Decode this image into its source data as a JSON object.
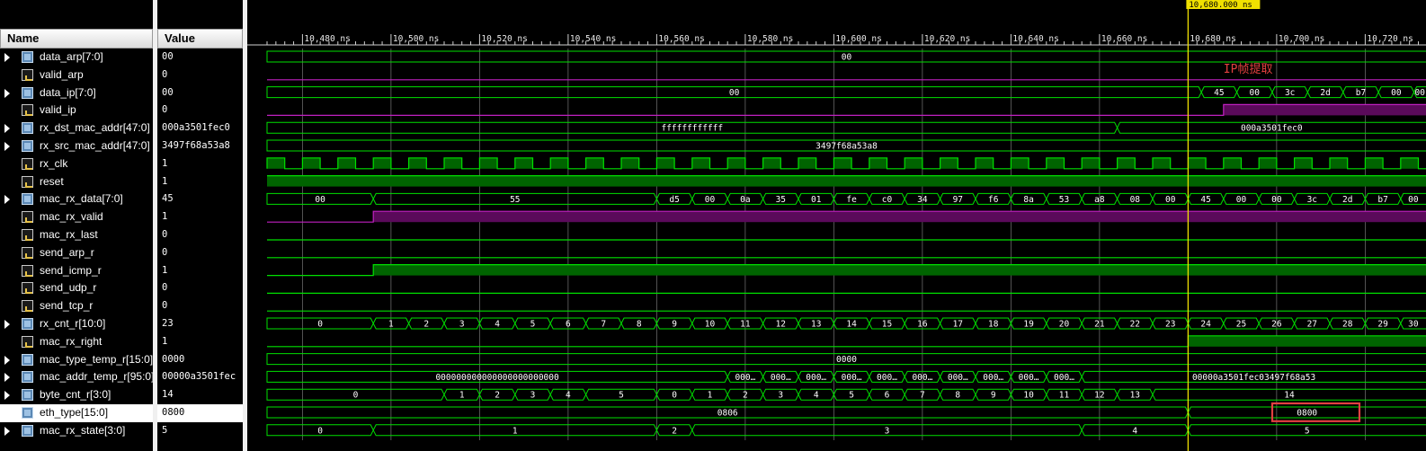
{
  "headers": {
    "name": "Name",
    "value": "Value"
  },
  "cursor": {
    "label": "10,680.000 ns",
    "time": 10680
  },
  "timescale": {
    "start": 10472,
    "end": 10735,
    "ticks": [
      10480,
      10500,
      10520,
      10540,
      10560,
      10580,
      10600,
      10620,
      10640,
      10660,
      10680,
      10700,
      10720
    ],
    "tick_suffix": " ns"
  },
  "annotation": {
    "text": "IP帧提取",
    "color": "#e24040"
  },
  "highlight_box": {
    "signal": "eth_type[15:0]",
    "value": "0800",
    "color": "#e24040"
  },
  "colors": {
    "bus": "#00e000",
    "bit_high_fill": "#006400",
    "purple": "#c020c0",
    "purple_fill": "#5a0a5a",
    "cursor": "#f0e000"
  },
  "signals": [
    {
      "name": "data_arp[7:0]",
      "value": "00",
      "type": "bus"
    },
    {
      "name": "valid_arp",
      "value": "0",
      "type": "bit"
    },
    {
      "name": "data_ip[7:0]",
      "value": "00",
      "type": "bus"
    },
    {
      "name": "valid_ip",
      "value": "0",
      "type": "bit"
    },
    {
      "name": "rx_dst_mac_addr[47:0]",
      "value": "000a3501fec0",
      "type": "bus"
    },
    {
      "name": "rx_src_mac_addr[47:0]",
      "value": "3497f68a53a8",
      "type": "bus"
    },
    {
      "name": "rx_clk",
      "value": "1",
      "type": "bit"
    },
    {
      "name": "reset",
      "value": "1",
      "type": "bit"
    },
    {
      "name": "mac_rx_data[7:0]",
      "value": "45",
      "type": "bus"
    },
    {
      "name": "mac_rx_valid",
      "value": "1",
      "type": "bit"
    },
    {
      "name": "mac_rx_last",
      "value": "0",
      "type": "bit"
    },
    {
      "name": "send_arp_r",
      "value": "0",
      "type": "bit"
    },
    {
      "name": "send_icmp_r",
      "value": "1",
      "type": "bit"
    },
    {
      "name": "send_udp_r",
      "value": "0",
      "type": "bit"
    },
    {
      "name": "send_tcp_r",
      "value": "0",
      "type": "bit"
    },
    {
      "name": "rx_cnt_r[10:0]",
      "value": "23",
      "type": "bus"
    },
    {
      "name": "mac_rx_right",
      "value": "1",
      "type": "bit"
    },
    {
      "name": "mac_type_temp_r[15:0]",
      "value": "0000",
      "type": "bus"
    },
    {
      "name": "mac_addr_temp_r[95:0]",
      "value": "00000a3501fec",
      "type": "bus"
    },
    {
      "name": "byte_cnt_r[3:0]",
      "value": "14",
      "type": "bus"
    },
    {
      "name": "eth_type[15:0]",
      "value": "0800",
      "type": "bus",
      "selected": true
    },
    {
      "name": "mac_rx_state[3:0]",
      "value": "5",
      "type": "bus"
    }
  ],
  "waves": {
    "data_arp": [
      [
        10472,
        "00"
      ]
    ],
    "valid_arp": [
      [
        10472,
        0
      ]
    ],
    "data_ip": [
      [
        10472,
        "00"
      ],
      [
        10683,
        "45"
      ],
      [
        10691,
        "00"
      ],
      [
        10699,
        "3c"
      ],
      [
        10707,
        "2d"
      ],
      [
        10715,
        "b7"
      ],
      [
        10723,
        "00"
      ],
      [
        10731,
        "00"
      ]
    ],
    "valid_ip": [
      [
        10472,
        0
      ],
      [
        10688,
        1
      ]
    ],
    "rx_dst_mac_addr": [
      [
        10472,
        "ffffffffffff"
      ],
      [
        10664,
        "000a3501fec0"
      ]
    ],
    "rx_src_mac_addr": [
      [
        10472,
        "3497f68a53a8"
      ]
    ],
    "rx_clk": {
      "period": 8,
      "phase": 10472
    },
    "reset": [
      [
        10472,
        1
      ]
    ],
    "mac_rx_data": [
      [
        10472,
        "00"
      ],
      [
        10496,
        "55"
      ],
      [
        10560,
        "d5"
      ],
      [
        10568,
        "00"
      ],
      [
        10576,
        "0a"
      ],
      [
        10584,
        "35"
      ],
      [
        10592,
        "01"
      ],
      [
        10600,
        "fe"
      ],
      [
        10608,
        "c0"
      ],
      [
        10616,
        "34"
      ],
      [
        10624,
        "97"
      ],
      [
        10632,
        "f6"
      ],
      [
        10640,
        "8a"
      ],
      [
        10648,
        "53"
      ],
      [
        10656,
        "a8"
      ],
      [
        10664,
        "08"
      ],
      [
        10672,
        "00"
      ],
      [
        10680,
        "45"
      ],
      [
        10688,
        "00"
      ],
      [
        10696,
        "00"
      ],
      [
        10704,
        "3c"
      ],
      [
        10712,
        "2d"
      ],
      [
        10720,
        "b7"
      ],
      [
        10728,
        "00"
      ]
    ],
    "mac_rx_valid": [
      [
        10472,
        0
      ],
      [
        10496,
        1
      ]
    ],
    "mac_rx_last": [
      [
        10472,
        0
      ]
    ],
    "send_arp_r": [
      [
        10472,
        0
      ]
    ],
    "send_icmp_r": [
      [
        10472,
        0
      ],
      [
        10496,
        1
      ]
    ],
    "send_udp_r": [
      [
        10472,
        0
      ]
    ],
    "send_tcp_r": [
      [
        10472,
        0
      ]
    ],
    "rx_cnt_r": [
      [
        10472,
        "0"
      ],
      [
        10496,
        "1"
      ],
      [
        10504,
        "2"
      ],
      [
        10512,
        "3"
      ],
      [
        10520,
        "4"
      ],
      [
        10528,
        "5"
      ],
      [
        10536,
        "6"
      ],
      [
        10544,
        "7"
      ],
      [
        10552,
        "8"
      ],
      [
        10560,
        "9"
      ],
      [
        10568,
        "10"
      ],
      [
        10576,
        "11"
      ],
      [
        10584,
        "12"
      ],
      [
        10592,
        "13"
      ],
      [
        10600,
        "14"
      ],
      [
        10608,
        "15"
      ],
      [
        10616,
        "16"
      ],
      [
        10624,
        "17"
      ],
      [
        10632,
        "18"
      ],
      [
        10640,
        "19"
      ],
      [
        10648,
        "20"
      ],
      [
        10656,
        "21"
      ],
      [
        10664,
        "22"
      ],
      [
        10672,
        "23"
      ],
      [
        10680,
        "24"
      ],
      [
        10688,
        "25"
      ],
      [
        10696,
        "26"
      ],
      [
        10704,
        "27"
      ],
      [
        10712,
        "28"
      ],
      [
        10720,
        "29"
      ],
      [
        10728,
        "30"
      ]
    ],
    "mac_rx_right": [
      [
        10472,
        0
      ],
      [
        10680,
        1
      ]
    ],
    "mac_type_temp_r": [
      [
        10472,
        "0000"
      ]
    ],
    "mac_addr_temp_r": [
      [
        10472,
        "000000000000000000000000"
      ],
      [
        10576,
        "000…"
      ],
      [
        10584,
        "000…"
      ],
      [
        10592,
        "000…"
      ],
      [
        10600,
        "000…"
      ],
      [
        10608,
        "000…"
      ],
      [
        10616,
        "000…"
      ],
      [
        10624,
        "000…"
      ],
      [
        10632,
        "000…"
      ],
      [
        10640,
        "000…"
      ],
      [
        10648,
        "000…"
      ],
      [
        10656,
        "00000a3501fec03497f68a53"
      ]
    ],
    "byte_cnt_r": [
      [
        10472,
        "0"
      ],
      [
        10512,
        "1"
      ],
      [
        10520,
        "2"
      ],
      [
        10528,
        "3"
      ],
      [
        10536,
        "4"
      ],
      [
        10544,
        "5"
      ],
      [
        10560,
        "0"
      ],
      [
        10568,
        "1"
      ],
      [
        10576,
        "2"
      ],
      [
        10584,
        "3"
      ],
      [
        10592,
        "4"
      ],
      [
        10600,
        "5"
      ],
      [
        10608,
        "6"
      ],
      [
        10616,
        "7"
      ],
      [
        10624,
        "8"
      ],
      [
        10632,
        "9"
      ],
      [
        10640,
        "10"
      ],
      [
        10648,
        "11"
      ],
      [
        10656,
        "12"
      ],
      [
        10664,
        "13"
      ],
      [
        10672,
        "14"
      ]
    ],
    "eth_type": [
      [
        10472,
        "0806"
      ],
      [
        10680,
        "0800"
      ]
    ],
    "mac_rx_state": [
      [
        10472,
        "0"
      ],
      [
        10496,
        "1"
      ],
      [
        10560,
        "2"
      ],
      [
        10568,
        "3"
      ],
      [
        10656,
        "4"
      ],
      [
        10680,
        "5"
      ]
    ]
  }
}
